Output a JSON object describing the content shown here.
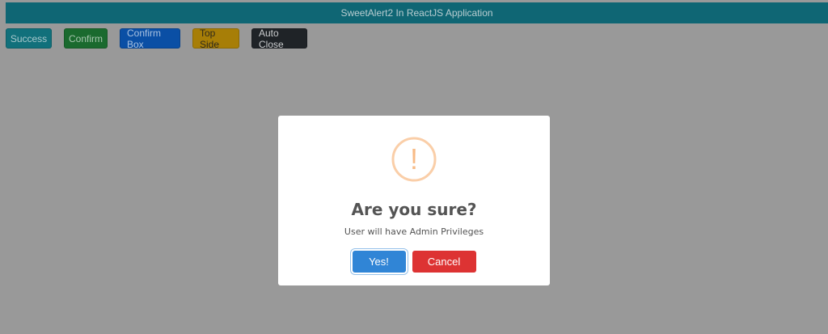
{
  "header": {
    "title": "SweetAlert2 In ReactJS Application"
  },
  "toolbar": {
    "success_label": "Success",
    "confirm_label": "Confirm",
    "confirm_box_label": "Confirm Box",
    "top_side_label": "Top Side",
    "auto_close_label": "Auto Close"
  },
  "dialog": {
    "icon": "warning-icon",
    "icon_glyph": "!",
    "icon_color": "#f8bb86",
    "title": "Are you sure?",
    "text": "User will have Admin Privileges",
    "confirm_label": "Yes!",
    "cancel_label": "Cancel",
    "confirm_color": "#3085d6",
    "cancel_color": "#dd3333"
  }
}
